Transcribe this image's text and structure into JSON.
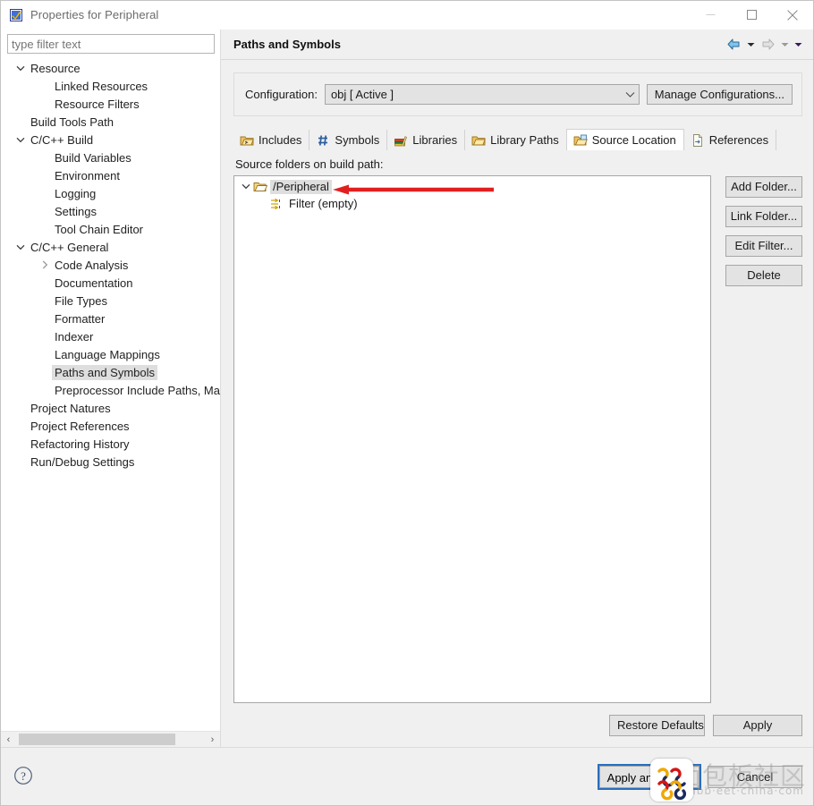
{
  "window": {
    "title": "Properties for Peripheral",
    "app_icon": "eclipse-checkmark-icon",
    "minimize_label": "Minimize",
    "maximize_label": "Maximize",
    "close_label": "Close"
  },
  "sidebar": {
    "filter_placeholder": "type filter text",
    "filter_value": "",
    "items": [
      {
        "label": "Resource",
        "indent": 0,
        "twisty": "expanded",
        "selected": false
      },
      {
        "label": "Linked Resources",
        "indent": 1,
        "twisty": "none",
        "selected": false
      },
      {
        "label": "Resource Filters",
        "indent": 1,
        "twisty": "none",
        "selected": false
      },
      {
        "label": "Build Tools Path",
        "indent": 0,
        "twisty": "none",
        "selected": false
      },
      {
        "label": "C/C++ Build",
        "indent": 0,
        "twisty": "expanded",
        "selected": false
      },
      {
        "label": "Build Variables",
        "indent": 1,
        "twisty": "none",
        "selected": false
      },
      {
        "label": "Environment",
        "indent": 1,
        "twisty": "none",
        "selected": false
      },
      {
        "label": "Logging",
        "indent": 1,
        "twisty": "none",
        "selected": false
      },
      {
        "label": "Settings",
        "indent": 1,
        "twisty": "none",
        "selected": false
      },
      {
        "label": "Tool Chain Editor",
        "indent": 1,
        "twisty": "none",
        "selected": false
      },
      {
        "label": "C/C++ General",
        "indent": 0,
        "twisty": "expanded",
        "selected": false
      },
      {
        "label": "Code Analysis",
        "indent": 1,
        "twisty": "collapsed",
        "selected": false
      },
      {
        "label": "Documentation",
        "indent": 1,
        "twisty": "none",
        "selected": false
      },
      {
        "label": "File Types",
        "indent": 1,
        "twisty": "none",
        "selected": false
      },
      {
        "label": "Formatter",
        "indent": 1,
        "twisty": "none",
        "selected": false
      },
      {
        "label": "Indexer",
        "indent": 1,
        "twisty": "none",
        "selected": false
      },
      {
        "label": "Language Mappings",
        "indent": 1,
        "twisty": "none",
        "selected": false
      },
      {
        "label": "Paths and Symbols",
        "indent": 1,
        "twisty": "none",
        "selected": true
      },
      {
        "label": "Preprocessor Include Paths, Macr",
        "indent": 1,
        "twisty": "none",
        "selected": false
      },
      {
        "label": "Project Natures",
        "indent": 0,
        "twisty": "none",
        "selected": false
      },
      {
        "label": "Project References",
        "indent": 0,
        "twisty": "none",
        "selected": false
      },
      {
        "label": "Refactoring History",
        "indent": 0,
        "twisty": "none",
        "selected": false
      },
      {
        "label": "Run/Debug Settings",
        "indent": 0,
        "twisty": "none",
        "selected": false
      }
    ],
    "scrollbar": {
      "left_arrow": "‹",
      "right_arrow": "›"
    }
  },
  "page": {
    "title": "Paths and Symbols",
    "nav": {
      "back_icon": "back-arrow-icon",
      "back_menu_icon": "chevron-down-icon",
      "forward_icon": "forward-arrow-icon",
      "forward_menu_icon": "chevron-down-icon",
      "overflow_icon": "chevron-down-icon"
    },
    "configuration": {
      "label": "Configuration:",
      "value": "obj  [ Active ]",
      "caret_icon": "chevron-down-icon",
      "manage_button": "Manage Configurations..."
    },
    "tabs": [
      {
        "label": "Includes",
        "icon": "includes-folder-icon",
        "active": false
      },
      {
        "label": "Symbols",
        "icon": "hash-icon",
        "active": false
      },
      {
        "label": "Libraries",
        "icon": "books-icon",
        "active": false
      },
      {
        "label": "Library Paths",
        "icon": "library-folder-icon",
        "active": false
      },
      {
        "label": "Source Location",
        "icon": "source-folder-icon",
        "active": true
      },
      {
        "label": "References",
        "icon": "references-page-icon",
        "active": false
      }
    ],
    "source_location": {
      "list_label": "Source folders on build path:",
      "tree": [
        {
          "label": "/Peripheral",
          "icon": "open-folder-icon",
          "twisty": "expanded",
          "indent": 0,
          "selected": true
        },
        {
          "label": "Filter (empty)",
          "icon": "filter-icon",
          "twisty": "none",
          "indent": 1,
          "selected": false
        }
      ],
      "buttons": [
        "Add Folder...",
        "Link Folder...",
        "Edit Filter...",
        "Delete"
      ]
    },
    "footer_buttons": {
      "restore_defaults": "Restore Defaults",
      "apply": "Apply"
    }
  },
  "bottom_bar": {
    "help_icon": "help-question-icon",
    "apply_and_close": "Apply and Close",
    "cancel": "Cancel"
  },
  "annotation": {
    "arrow": "red-left-arrow",
    "color": "#e02020"
  },
  "watermark": {
    "text": "面包板社区",
    "subtext": "mbb·eet·china·com",
    "logo": "watermark-logo-icon"
  },
  "colors": {
    "dialog_bg": "#f0f0f0",
    "list_bg": "#ffffff",
    "selection": "#dedede",
    "default_button_outline": "#2a6ebd",
    "annotation_red": "#e02020"
  }
}
